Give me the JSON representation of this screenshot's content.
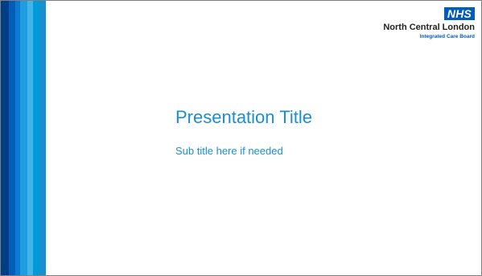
{
  "logo": {
    "nhs": "NHS",
    "org_name": "North Central London",
    "org_subtitle": "Integrated Care Board"
  },
  "slide": {
    "title": "Presentation Title",
    "subtitle": "Sub title here if needed"
  },
  "colors": {
    "nhs_blue": "#005eb8",
    "title_blue": "#1a8fd0",
    "stripes": [
      "#003d87",
      "#005eb8",
      "#0a7bd0",
      "#1f9de0",
      "#41b6e6",
      "#009ad8",
      "#1a8fd0"
    ]
  }
}
